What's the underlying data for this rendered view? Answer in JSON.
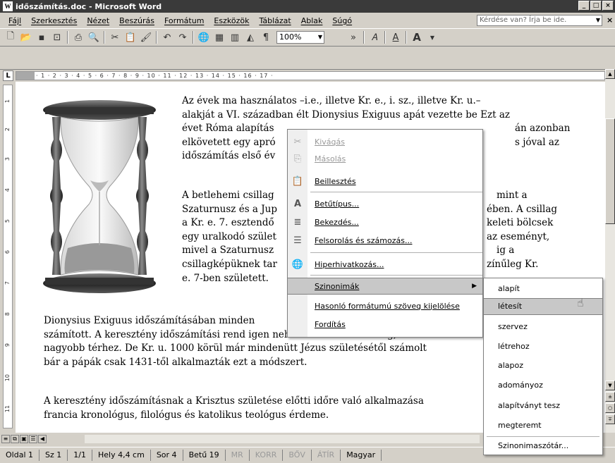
{
  "window": {
    "title": "időszámítás.doc - Microsoft Word",
    "app_icon": "word-icon",
    "controls": [
      "_",
      "□",
      "×"
    ]
  },
  "menubar": {
    "items": [
      "Fájl",
      "Szerkesztés",
      "Nézet",
      "Beszúrás",
      "Formátum",
      "Eszközök",
      "Táblázat",
      "Ablak",
      "Súgó"
    ],
    "ask_placeholder": "Kérdése van? Írja be ide.",
    "close": "×"
  },
  "toolbar": {
    "icons": [
      "new-document-icon",
      "open-icon",
      "save-icon",
      "permission-icon",
      "print-icon",
      "print-preview-icon",
      "cut-icon",
      "paste-icon",
      "format-painter-icon",
      "undo-icon",
      "redo-icon",
      "hyperlink-icon",
      "table-icon",
      "columns-icon",
      "drawing-icon",
      "paragraph-mark-icon"
    ],
    "zoom": "100%",
    "font_buttons": [
      "A",
      "A"
    ]
  },
  "ruler": {
    "marks": "· 1 · 2 · 3 · 4 · 5 · 6 · 7 · 8 · 9 · 10 · 11 · 12 · 13 · 14 · 15 · 16 · 17 ·",
    "vertical": [
      "1",
      "2",
      "3",
      "4",
      "5",
      "6",
      "7",
      "8",
      "9",
      "10",
      "11"
    ]
  },
  "document": {
    "para1": [
      "Az évek ma használatos –i.e., illetve Kr. e., i. sz., illetve Kr. u.–",
      "alakját a VI. században élt Dionysius Exiguus apát vezette be Ezt az",
      "évet Róma alapítás",
      "elkövetett egy apró",
      "időszámítás első év"
    ],
    "para2": [
      "A betlehemi csillag",
      "Szaturnusz és a Jup",
      "a Kr. e. 7. esztendő",
      "egy uralkodó szület",
      "mivel a Szaturnusz",
      "csillagképüknek tar",
      "e. 7-ben született."
    ],
    "para2_right": [
      "mint a",
      "ében. A csillag",
      "keleti bölcsek",
      "az eseményt,",
      "ig a",
      "zínűleg Kr."
    ],
    "para1_right": [
      "án azonban",
      "s jóval az"
    ],
    "para3": [
      "Dionysius Exiguus időszámításában minden",
      "számított. A keresztény időszámítási rend igen nehezen honosodott meg, csak a",
      "nagyobb térhez. De Kr. u. 1000 körül már mindenütt Jézus születésétől számolt",
      "bár a pápák csak 1431-től alkalmazták ezt a módszert."
    ],
    "para4": [
      "A keresztény időszámításnak a Krisztus születése előtti időre való alkalmazása",
      "francia kronológus, filológus és katolikus teológus érdeme."
    ]
  },
  "context_menu": {
    "items": [
      {
        "label": "Kivágás",
        "icon": "cut-icon",
        "disabled": true
      },
      {
        "label": "Másolás",
        "icon": "copy-icon",
        "disabled": true
      },
      {
        "label": "Beillesztés",
        "icon": "paste-icon",
        "disabled": false
      },
      {
        "label": "Betűtípus...",
        "icon": "font-icon",
        "disabled": false
      },
      {
        "label": "Bekezdés...",
        "icon": "paragraph-icon",
        "disabled": false
      },
      {
        "label": "Felsorolás és számozás...",
        "icon": "bullets-icon",
        "disabled": false
      },
      {
        "label": "Hiperhivatkozás...",
        "icon": "hyperlink-icon",
        "disabled": false
      },
      {
        "label": "Szinonimák",
        "icon": "",
        "disabled": false,
        "submenu": true
      },
      {
        "label": "Hasonló formátumú szöveg kijelölése",
        "icon": "",
        "disabled": false
      },
      {
        "label": "Fordítás",
        "icon": "",
        "disabled": false
      }
    ]
  },
  "synonyms_submenu": {
    "items": [
      "alapít",
      "létesít",
      "szervez",
      "létrehoz",
      "alapoz",
      "adományoz",
      "alapítványt tesz",
      "megteremt"
    ],
    "thesaurus": "Szinonimaszótár...",
    "selected": "létesít"
  },
  "statusbar": {
    "page": "Oldal 1",
    "section": "Sz 1",
    "pages": "1/1",
    "position": "Hely 4,4 cm",
    "line": "Sor 4",
    "column": "Betű 19",
    "modes": [
      "MR",
      "KORR",
      "BŐV",
      "ÁTÍR"
    ],
    "language": "Magyar"
  }
}
